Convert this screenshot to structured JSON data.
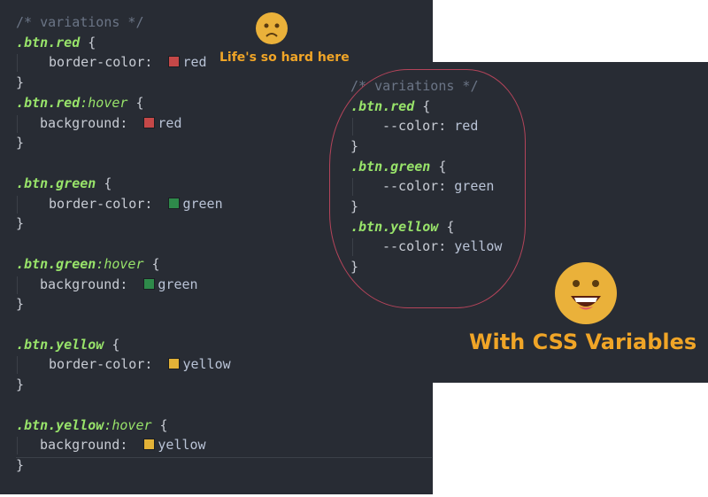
{
  "left_code": {
    "comment": "/* variations */",
    "blocks": [
      {
        "selector": ".btn.red",
        "pseudo": "",
        "prop": "border-color",
        "value": "red",
        "swatch": "#c54848"
      },
      {
        "selector": ".btn.red",
        "pseudo": ":hover",
        "prop": "background",
        "value": "red",
        "swatch": "#c54848"
      },
      {
        "selector": ".btn.green",
        "pseudo": "",
        "prop": "border-color",
        "value": "green",
        "swatch": "#2e8a4a"
      },
      {
        "selector": ".btn.green",
        "pseudo": ":hover",
        "prop": "background",
        "value": "green",
        "swatch": "#2e8a4a"
      },
      {
        "selector": ".btn.yellow",
        "pseudo": "",
        "prop": "border-color",
        "value": "yellow",
        "swatch": "#e3b237"
      },
      {
        "selector": ".btn.yellow",
        "pseudo": ":hover",
        "prop": "background",
        "value": "yellow",
        "swatch": "#e3b237"
      }
    ],
    "open_brace": "{",
    "close_brace": "}",
    "colon": ":"
  },
  "right_code": {
    "comment": "/* variations */",
    "blocks": [
      {
        "selector": ".btn.red",
        "prop": "--color",
        "value": "red"
      },
      {
        "selector": ".btn.green",
        "prop": "--color",
        "value": "green"
      },
      {
        "selector": ".btn.yellow",
        "prop": "--color",
        "value": "yellow"
      }
    ]
  },
  "sad_caption": "Life's so hard here",
  "happy_caption": "With CSS Variables",
  "colors": {
    "editor_bg": "#282c34",
    "selector": "#98e36a",
    "caption": "#f0a527",
    "oval": "#b4445a",
    "emoji": "#eab13a"
  }
}
